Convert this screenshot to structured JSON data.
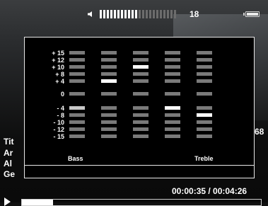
{
  "status": {
    "volume_value": "18",
    "volume_level": 0.5,
    "volume_segments": 22
  },
  "track": {
    "title_label": "Tit",
    "artist_label": "Ar",
    "album_label": "Al",
    "genre_label": "Ge",
    "track_number_fragment": "68"
  },
  "equalizer": {
    "scale_labels": [
      "+ 15",
      "+ 12",
      "+ 10",
      "+ 8",
      "+ 4",
      "0",
      "- 4",
      "- 8",
      "- 10",
      "- 12",
      "- 15"
    ],
    "band_low_label": "Bass",
    "band_high_label": "Treble",
    "bands": [
      {
        "level": "- 4",
        "state": "dim"
      },
      {
        "level": "+ 4",
        "state": "selected"
      },
      {
        "level": "+ 10",
        "state": "selected"
      },
      {
        "level": "- 4",
        "state": "selected"
      },
      {
        "level": "- 8",
        "state": "selected"
      }
    ]
  },
  "playback": {
    "time_display": "00:00:35 / 00:04:26",
    "elapsed_seconds": 35,
    "total_seconds": 266
  },
  "colors": {
    "bar_inactive": "#7a7a7a",
    "bar_selected": "#ffffff",
    "panel_border": "#e8e8e8"
  }
}
